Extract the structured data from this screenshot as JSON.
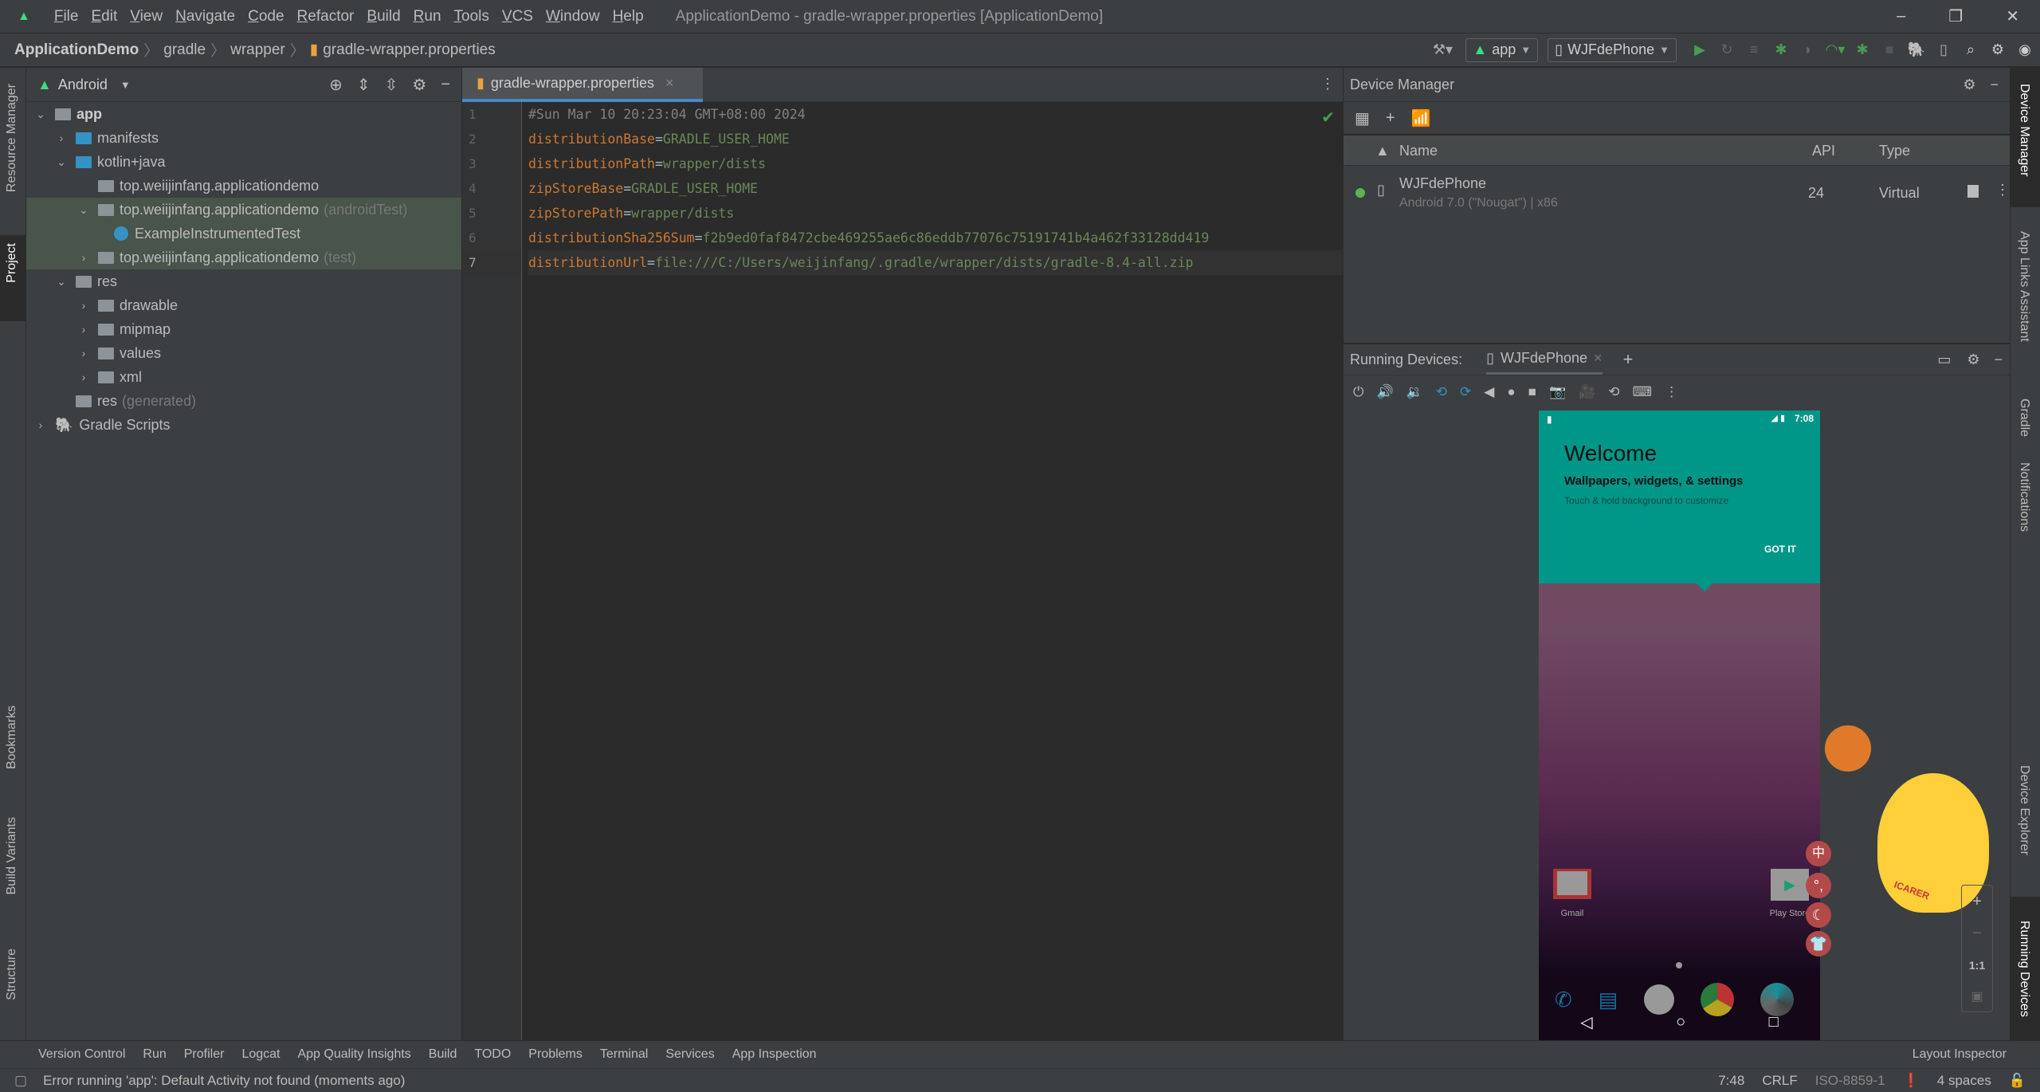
{
  "window": {
    "title": "ApplicationDemo - gradle-wrapper.properties [ApplicationDemo]",
    "menu": [
      "File",
      "Edit",
      "View",
      "Navigate",
      "Code",
      "Refactor",
      "Build",
      "Run",
      "Tools",
      "VCS",
      "Window",
      "Help"
    ]
  },
  "breadcrumb": [
    "ApplicationDemo",
    "gradle",
    "wrapper",
    "gradle-wrapper.properties"
  ],
  "toolbar": {
    "run_config": "app",
    "device": "WJFdePhone"
  },
  "left_stripe": [
    "Resource Manager",
    "Project",
    "Bookmarks",
    "Build Variants",
    "Structure"
  ],
  "project": {
    "view": "Android",
    "tree": [
      {
        "label": "app",
        "hint": ""
      },
      {
        "label": "manifests",
        "hint": ""
      },
      {
        "label": "kotlin+java",
        "hint": ""
      },
      {
        "label": "top.weiijinfang.applicationdemo",
        "hint": ""
      },
      {
        "label": "top.weiijinfang.applicationdemo",
        "hint": "(androidTest)"
      },
      {
        "label": "ExampleInstrumentedTest",
        "hint": ""
      },
      {
        "label": "top.weiijinfang.applicationdemo",
        "hint": "(test)"
      },
      {
        "label": "res",
        "hint": ""
      },
      {
        "label": "drawable",
        "hint": ""
      },
      {
        "label": "mipmap",
        "hint": ""
      },
      {
        "label": "values",
        "hint": ""
      },
      {
        "label": "xml",
        "hint": ""
      },
      {
        "label": "res",
        "hint": "(generated)"
      },
      {
        "label": "Gradle Scripts",
        "hint": ""
      }
    ]
  },
  "editor": {
    "tab": "gradle-wrapper.properties",
    "lines": [
      {
        "n": "1",
        "key": "#Sun Mar 10 20:23:04 GMT+08:00 2024",
        "val": ""
      },
      {
        "n": "2",
        "key": "distributionBase",
        "val": "GRADLE_USER_HOME"
      },
      {
        "n": "3",
        "key": "distributionPath",
        "val": "wrapper/dists"
      },
      {
        "n": "4",
        "key": "zipStoreBase",
        "val": "GRADLE_USER_HOME"
      },
      {
        "n": "5",
        "key": "zipStorePath",
        "val": "wrapper/dists"
      },
      {
        "n": "6",
        "key": "distributionSha256Sum",
        "val": "f2b9ed0faf8472cbe469255ae6c86eddb77076c75191741b4a462f33128dd419"
      },
      {
        "n": "7",
        "key": "distributionUrl",
        "val": "file:///C:/Users/weijinfang/.gradle/wrapper/dists/gradle-8.4-all.zip"
      }
    ],
    "eq": "="
  },
  "device_manager": {
    "title": "Device Manager",
    "columns": [
      "Name",
      "API",
      "Type"
    ],
    "device": {
      "name": "WJFdePhone",
      "desc": "Android 7.0 (\"Nougat\") | x86",
      "api": "24",
      "type": "Virtual",
      "status_color": "#5fb34a"
    }
  },
  "running_devices": {
    "label": "Running Devices:",
    "tab": "WJFdePhone",
    "zoom_ratio": "1:1"
  },
  "phone": {
    "time": "7:08",
    "welcome": "Welcome",
    "subtitle": "Wallpapers, widgets, & settings",
    "hint": "Touch & hold background to customize",
    "got_it": "GOT IT",
    "apps": [
      "Gmail",
      "Play Store"
    ],
    "overlay_text": "ICARER",
    "overlay_chars": [
      "中"
    ],
    "teal": "#009688"
  },
  "right_stripe": [
    "Device Manager",
    "App Links Assistant",
    "Gradle",
    "Notifications",
    "Device Explorer",
    "Running Devices"
  ],
  "bottom_tools": [
    "Version Control",
    "Run",
    "Profiler",
    "Logcat",
    "App Quality Insights",
    "Build",
    "TODO",
    "Problems",
    "Terminal",
    "Services",
    "App Inspection"
  ],
  "layout_inspector": "Layout Inspector",
  "status": {
    "message": "Error running 'app': Default Activity not found (moments ago)",
    "position": "7:48",
    "line_sep": "CRLF",
    "encoding": "ISO-8859-1",
    "indent": "4 spaces"
  }
}
